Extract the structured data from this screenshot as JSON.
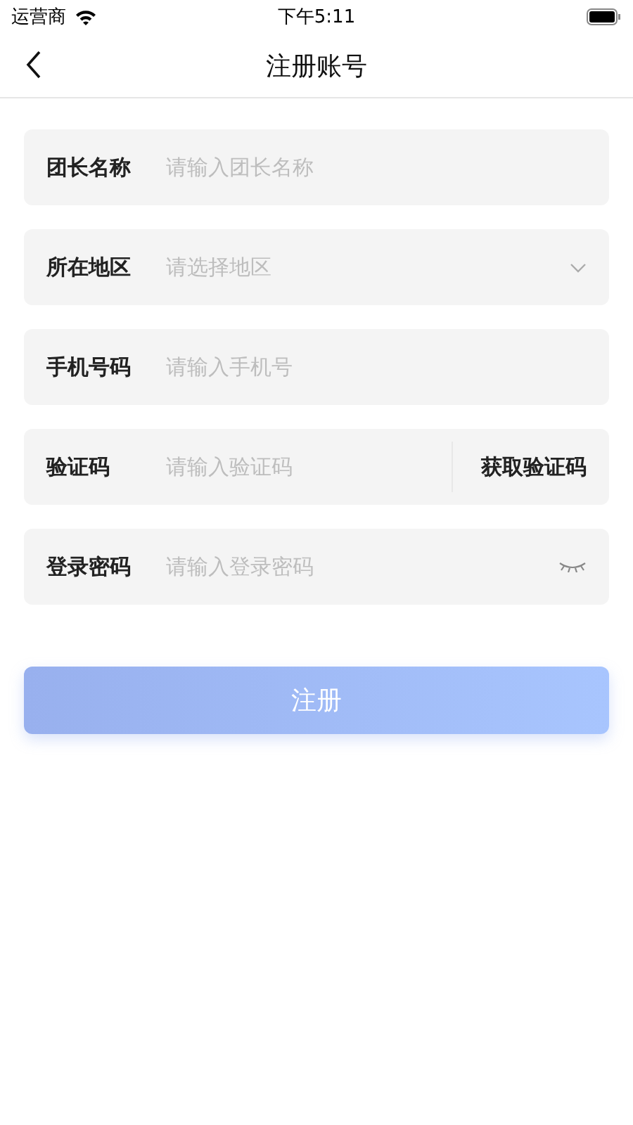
{
  "status_bar": {
    "carrier": "运营商",
    "time": "下午5:11"
  },
  "nav": {
    "title": "注册账号"
  },
  "fields": [
    {
      "kind": "text",
      "label": "团长名称",
      "placeholder": "请输入团长名称"
    },
    {
      "kind": "select",
      "label": "所在地区",
      "placeholder": "请选择地区"
    },
    {
      "kind": "text",
      "label": "手机号码",
      "placeholder": "请输入手机号"
    },
    {
      "kind": "code",
      "label": "验证码",
      "placeholder": "请输入验证码",
      "action": "获取验证码"
    },
    {
      "kind": "password",
      "label": "登录密码",
      "placeholder": "请输入登录密码"
    }
  ],
  "submit": {
    "label": "注册",
    "disabled": true
  }
}
